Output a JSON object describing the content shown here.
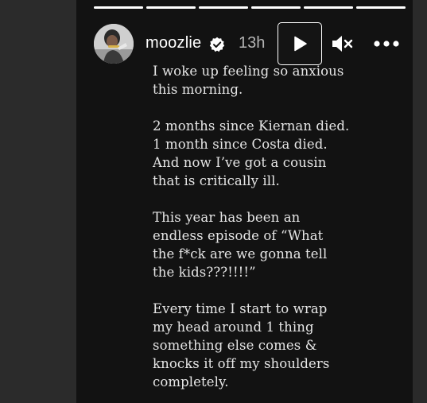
{
  "story": {
    "username": "moozlie",
    "time_ago": "13h",
    "progress_segments": [
      1,
      1,
      1,
      1,
      1,
      1
    ],
    "icons": {
      "verified": "verified-badge-icon",
      "play": "play-icon",
      "mute": "speaker-muted-icon",
      "more": "more-options-icon"
    },
    "paragraphs": [
      {
        "lines": [
          "I woke up feeling so anxious",
          "this morning."
        ]
      },
      {
        "lines": [
          "2 months since Kiernan died.",
          "1 month since Costa died.",
          "And now I’ve got a cousin",
          "that is critically ill."
        ]
      },
      {
        "lines": [
          "This year has been an",
          "endless episode of “What",
          "the f*ck are we gonna tell",
          "the kids???!!!!”"
        ]
      },
      {
        "lines": [
          "Every time I start to wrap",
          "my head around 1 thing",
          "something else comes &",
          "knocks it off my shoulders",
          "completely."
        ]
      }
    ]
  }
}
